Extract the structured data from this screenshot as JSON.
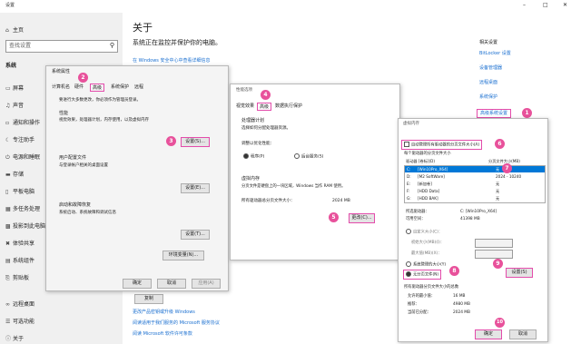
{
  "window_title": "设置",
  "sidebar": {
    "home": "主页",
    "search_placeholder": "查找设置",
    "section": "系统",
    "items": [
      "屏幕",
      "声音",
      "通知和操作",
      "专注助手",
      "电源和睡眠",
      "存储",
      "平板电脑",
      "多任务处理",
      "投影到此电脑",
      "体验共享",
      "系统组件",
      "剪贴板",
      "远程桌面",
      "可选功能",
      "关于"
    ]
  },
  "main": {
    "title": "关于",
    "subtitle": "系统正在监控并保护你的电脑。",
    "security_link": "在 Windows 安全中心中查看详细信息",
    "copy_button": "复制",
    "link_update": "更改产品密钥或升级 Windows",
    "link_services": "阅读适用于我们服务的 Microsoft 服务协议",
    "link_license": "阅读 Microsoft 软件许可条款"
  },
  "related": {
    "title": "相关设置",
    "links": [
      "BitLocker 设置",
      "设备管理器",
      "远程桌面",
      "系统保护",
      "高级系统设置"
    ]
  },
  "sysprops": {
    "title": "系统属性",
    "tabs": [
      "计算机名",
      "硬件",
      "高级",
      "系统保护",
      "远程"
    ],
    "note": "要进行大多数更改，你必须作为管理员登录。",
    "perf_title": "性能",
    "perf_desc": "视觉效果，处理器计划，内存使用，以及虚拟内存",
    "settings_btn": "设置(S)...",
    "profile_title": "用户配置文件",
    "profile_desc": "与登录帐户相关的桌面设置",
    "settings_btn2": "设置(E)...",
    "startup_title": "启动和故障恢复",
    "startup_desc": "系统启动、系统故障和调试信息",
    "settings_btn3": "设置(T)...",
    "env_btn": "环境变量(N)...",
    "ok": "确定",
    "cancel": "取消",
    "apply": "应用(A)"
  },
  "perfopts": {
    "title": "性能选项",
    "tabs": [
      "视觉效果",
      "高级",
      "数据执行保护"
    ],
    "sched_title": "处理器计划",
    "sched_desc": "选择如何分配处理器资源。",
    "adjust_label": "调整以优化性能：",
    "opt_programs": "程序(P)",
    "opt_background": "后台服务(S)",
    "vm_title": "虚拟内存",
    "vm_desc": "分页文件是硬盘上的一块区域，Windows 当作 RAM 使用。",
    "total_label": "所有驱动器总分页文件大小：",
    "total_value": "2024 MB",
    "change_btn": "更改(C)..."
  },
  "vmem": {
    "title": "虚拟内存",
    "auto_manage": "自动管理所有驱动器的分页文件大小(A)",
    "per_drive": "每个驱动器的分页文件大小",
    "col_drive": "驱动器 [卷标](D)",
    "col_size": "分页文件大小(MB)",
    "drives": [
      {
        "drive": "C:",
        "label": "[Win10Pro_X64]",
        "size": "无"
      },
      {
        "drive": "D:",
        "label": "[M2 SoftWare]",
        "size": "2024 - 10240"
      },
      {
        "drive": "E:",
        "label": "[新加卷]",
        "size": "无"
      },
      {
        "drive": "F:",
        "label": "[HDD Data]",
        "size": "无"
      },
      {
        "drive": "G:",
        "label": "[HDD BAK]",
        "size": "无"
      }
    ],
    "sel_drive_label": "所选驱动器：",
    "sel_drive_value": "C: [Win10Pro_X64]",
    "free_label": "可用空间：",
    "free_value": "41398 MB",
    "custom_size": "自定义大小(C)：",
    "initial_size": "初始大小(MB)(I)：",
    "max_size": "最大值(MB)(X)：",
    "system_managed": "系统管理的大小(Y)",
    "no_paging": "无分页文件(N)",
    "set_btn": "设置(S)",
    "totals_title": "所有驱动器分页文件大小的总数",
    "min_label": "允许的最小值：",
    "min_value": "16 MB",
    "rec_label": "推荐：",
    "rec_value": "4980 MB",
    "cur_label": "当前已分配：",
    "cur_value": "2024 MB",
    "ok": "确定",
    "cancel": "取消"
  },
  "badges": [
    "1",
    "2",
    "3",
    "4",
    "5",
    "6",
    "7",
    "8",
    "9",
    "10"
  ],
  "colors": {
    "accent": "#e34cab",
    "link": "#1a6fd0",
    "selection": "#0078d7"
  }
}
